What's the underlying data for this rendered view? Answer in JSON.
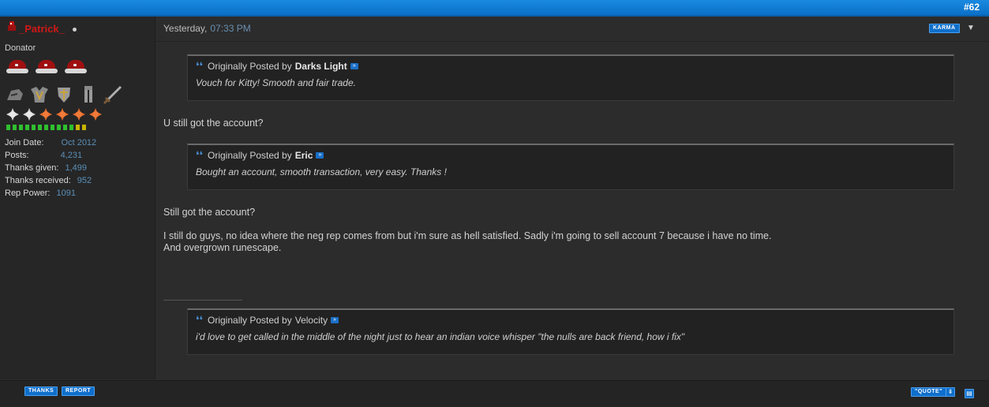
{
  "post": {
    "number": "#62",
    "date": "Yesterday,",
    "time": "07:33 PM"
  },
  "user": {
    "name": "_Patrick_",
    "title": "Donator",
    "stats": [
      {
        "label": "Join Date:",
        "value": "Oct 2012"
      },
      {
        "label": "Posts:",
        "value": "4,231"
      },
      {
        "label": "Thanks given:",
        "value": "1,499"
      },
      {
        "label": "Thanks received:",
        "value": "952"
      },
      {
        "label": "Rep Power:",
        "value": "1091"
      }
    ]
  },
  "buttons": {
    "karma": "Karma",
    "thanks": "Thanks",
    "report": "Report",
    "quote": "\"Quote\""
  },
  "quotes": [
    {
      "prefix": "Originally Posted by",
      "author": "Darks Light",
      "text": "Vouch for Kitty! Smooth and fair trade."
    },
    {
      "prefix": "Originally Posted by",
      "author": "Eric",
      "text": "Bought an account, smooth transaction, very easy. Thanks !"
    },
    {
      "prefix": "Originally Posted by",
      "author": "Velocity",
      "text": "i'd love to get called in the middle of the night just to hear an indian voice whisper \"the nulls are back friend, how i fix\""
    }
  ],
  "body": {
    "line1": "U still got the account?",
    "line2": "Still got the account?",
    "line3": "I still do guys, no idea where the neg rep comes from but i'm sure as hell satisfied. Sadly i'm going to sell account 7 because i have no time.",
    "line4": "And overgrown runescape."
  },
  "colors": {
    "accent": "#0f6fcb",
    "username": "#d01818",
    "link": "#5a8fb8"
  }
}
